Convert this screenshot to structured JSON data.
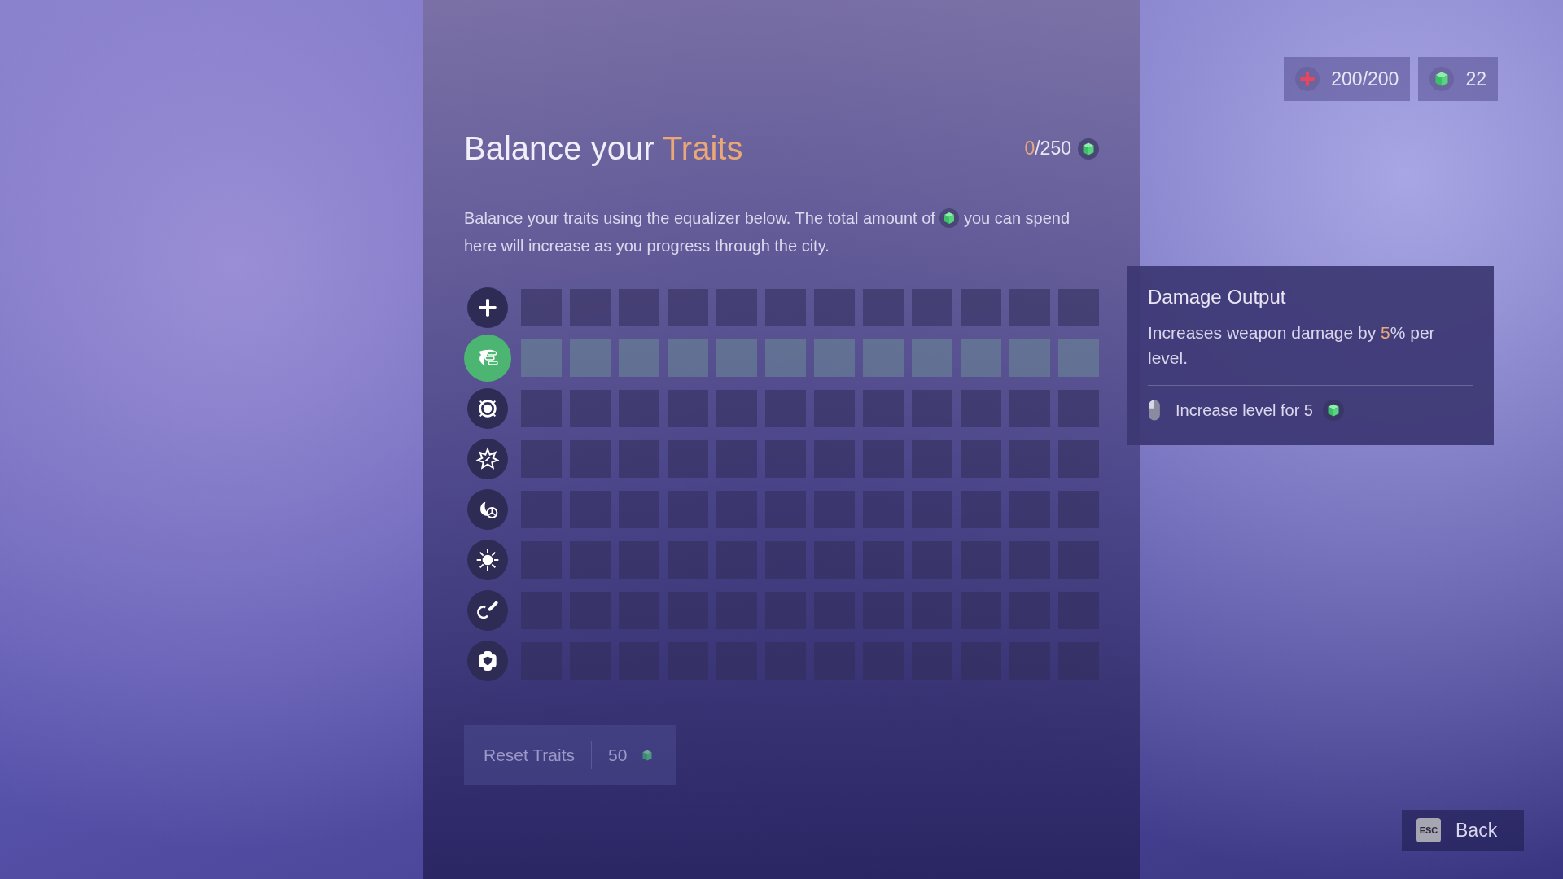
{
  "stats": {
    "health": "200/200",
    "cubes": "22"
  },
  "header": {
    "title_before": "Balance your ",
    "title_highlight": "Traits",
    "points_spent": "0",
    "points_total": "/250"
  },
  "description": {
    "before": "Balance your traits using the equalizer below. The total amount of",
    "after": "you can spend here will increase as you progress through the city."
  },
  "traits": [
    {
      "kind": "plus",
      "selected": false
    },
    {
      "kind": "wing",
      "selected": true
    },
    {
      "kind": "ring",
      "selected": false
    },
    {
      "kind": "star",
      "selected": false
    },
    {
      "kind": "moon",
      "selected": false
    },
    {
      "kind": "sun",
      "selected": false
    },
    {
      "kind": "magnet",
      "selected": false
    },
    {
      "kind": "shield",
      "selected": false
    }
  ],
  "reset_button": {
    "label": "Reset Traits",
    "cost": "50",
    "disabled": true
  },
  "tooltip": {
    "title": "Damage Output",
    "text_before": "Increases weapon damage by ",
    "text_highlight": "5",
    "text_after": "% per level.",
    "action": "Increase level for 5"
  },
  "back_button": {
    "key": "ESC",
    "label": "Back"
  }
}
